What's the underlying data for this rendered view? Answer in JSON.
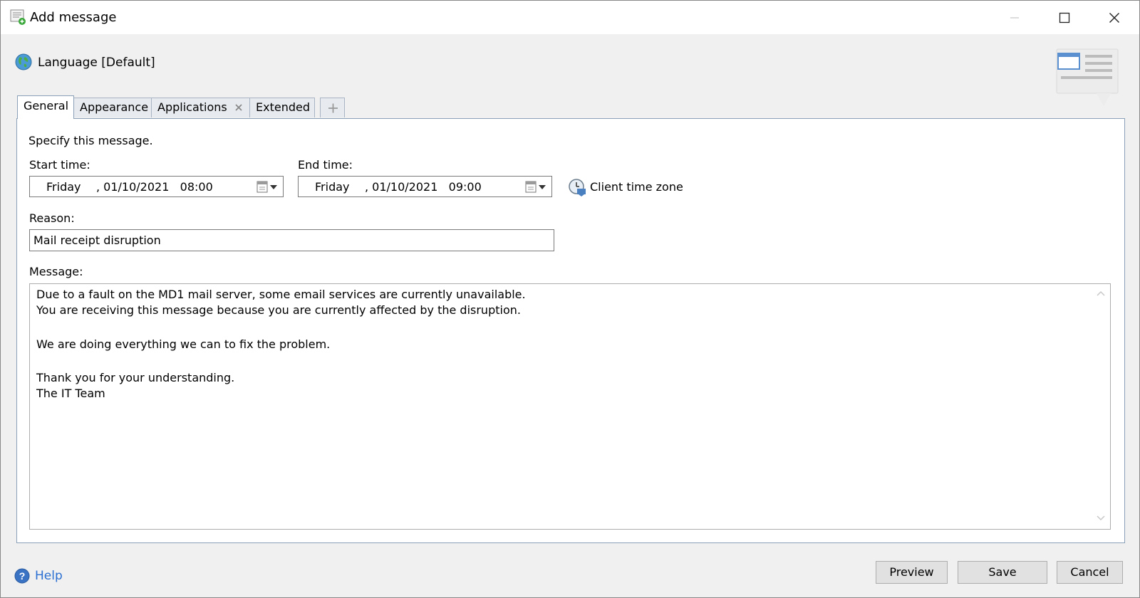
{
  "window": {
    "title": "Add message"
  },
  "language": {
    "label": "Language [Default]"
  },
  "tabs": [
    {
      "label": "General",
      "active": true
    },
    {
      "label": "Appearance",
      "active": false
    },
    {
      "label": "Applications",
      "active": false,
      "closable": true
    },
    {
      "label": "Extended",
      "active": false
    }
  ],
  "general": {
    "description": "Specify this message.",
    "start_time": {
      "label": "Start time:",
      "day": "Friday",
      "datetime": ", 01/10/2021   08:00"
    },
    "end_time": {
      "label": "End time:",
      "day": "Friday",
      "datetime": ", 01/10/2021   09:00"
    },
    "timezone_label": "Client time zone",
    "reason": {
      "label": "Reason:",
      "value": "Mail receipt disruption"
    },
    "message": {
      "label": "Message:",
      "lines": [
        "Due to a fault on the MD1 mail server, some email services are currently unavailable.",
        "You are receiving this message because you are currently affected by the disruption.",
        "We are doing everything we can to fix the problem.",
        "Thank you for your understanding.",
        "The IT Team"
      ]
    }
  },
  "footer": {
    "help_label": "Help",
    "preview_label": "Preview",
    "save_label": "Save",
    "cancel_label": "Cancel"
  },
  "colors": {
    "accent": "#2a6fd1",
    "panel_border": "#8aa0b8",
    "tab_bg": "#e7eaef"
  }
}
